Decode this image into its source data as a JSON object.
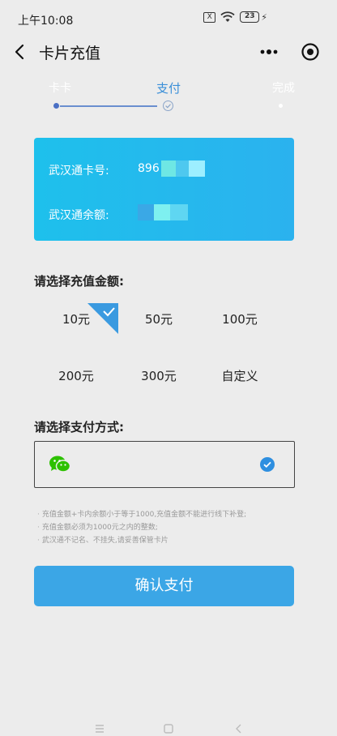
{
  "status_bar": {
    "time": "上午10:08",
    "sim_label": "X",
    "battery": "23"
  },
  "nav": {
    "title": "卡片充值"
  },
  "steps": {
    "items": [
      {
        "label": "卡卡"
      },
      {
        "label": "支付"
      },
      {
        "label": "完成"
      }
    ]
  },
  "card": {
    "card_no_label": "武汉通卡号:",
    "card_no_value": "896",
    "balance_label": "武汉通余额:"
  },
  "amount": {
    "title": "请选择充值金额:",
    "options": [
      {
        "label": "10元",
        "selected": true
      },
      {
        "label": "50元"
      },
      {
        "label": "100元"
      },
      {
        "label": "200元"
      },
      {
        "label": "300元"
      },
      {
        "label": "自定义"
      }
    ]
  },
  "payment": {
    "title": "请选择支付方式:",
    "method_icon": "wechat-icon",
    "selected": true
  },
  "notes": [
    "充值金额+卡内余额小于等于1000,充值金额不能进行线下补登;",
    "充值金额必须为1000元之内的整数;",
    "武汉通不记名、不挂失,请妥善保管卡片"
  ],
  "confirm_label": "确认支付",
  "colors": {
    "accent": "#3ba6e6",
    "card_gradient_start": "#1ec0ec",
    "card_gradient_end": "#2bb2ee",
    "wechat_green": "#2dc100"
  }
}
